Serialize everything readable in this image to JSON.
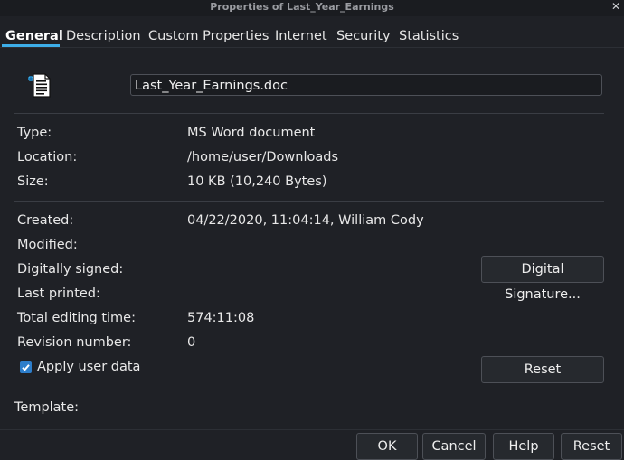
{
  "window": {
    "title": "Properties of Last_Year_Earnings"
  },
  "tabs": [
    {
      "label": "General",
      "active": true
    },
    {
      "label": "Description"
    },
    {
      "label": "Custom Properties"
    },
    {
      "label": "Internet"
    },
    {
      "label": "Security"
    },
    {
      "label": "Statistics"
    }
  ],
  "file": {
    "name": "Last_Year_Earnings.doc",
    "icon": "document-icon"
  },
  "props": {
    "type_label": "Type:",
    "type_value": "MS Word document",
    "location_label": "Location:",
    "location_value": "/home/user/Downloads",
    "size_label": "Size:",
    "size_value": "10 KB (10,240 Bytes)",
    "created_label": "Created:",
    "created_value": "04/22/2020, 11:04:14, William Cody",
    "modified_label": "Modified:",
    "signed_label": "Digitally signed:",
    "printed_label": "Last printed:",
    "editing_label": "Total editing time:",
    "editing_value": "574:11:08",
    "revision_label": "Revision number:",
    "revision_value": "0"
  },
  "apply_user_data": {
    "label": "Apply user data",
    "checked": true
  },
  "buttons": {
    "digital_signature": "Digital Signature...",
    "reset_props": "Reset",
    "ok": "OK",
    "cancel": "Cancel",
    "help": "Help",
    "reset": "Reset"
  },
  "template_label": "Template:",
  "colors": {
    "accent": "#3daee9",
    "background": "#1f2126",
    "checkbox": "#2d7ecb"
  }
}
